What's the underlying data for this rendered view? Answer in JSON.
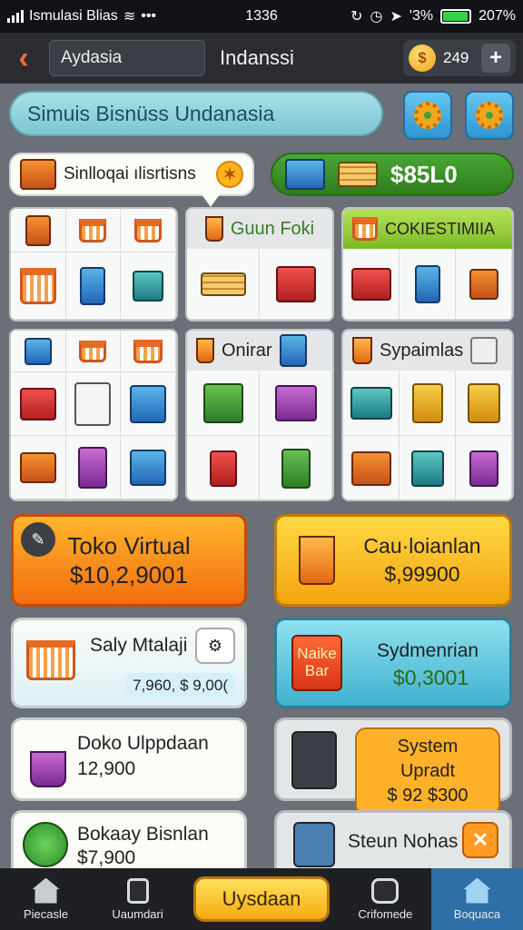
{
  "status_bar": {
    "carrier": "Ismulasi Blias",
    "time": "1336",
    "battery": "207%",
    "signal_pct": "'3%"
  },
  "top_bar": {
    "field_value": "Aydasia",
    "title": "Indanssi",
    "coins": "249"
  },
  "banner": {
    "title": "Simuis Bisnüss Undanasia"
  },
  "chips": {
    "left_label": "Sinlloqai ılisrtisns",
    "right_value": "$85L0"
  },
  "panels": {
    "mid_top_label": "Guun Foki",
    "right_top_label": "COKIESTIMIIA",
    "mid_bottom_label": "Onirar",
    "right_bottom_label": "Sypaimlas"
  },
  "cards": [
    {
      "title": "Toko Virtual",
      "value": "$10,2,9001"
    },
    {
      "title": "Cau·loianlan",
      "value": "$,99900"
    },
    {
      "title": "Saly Mtalaji",
      "value": "7,960, $ 9,00("
    },
    {
      "title": "Sydmenrian",
      "value": "$0,3001",
      "badge": "Naike Bar"
    },
    {
      "title": "Doko Ulppdaan",
      "value": "12,900"
    },
    {
      "title": "System Upradt",
      "value": "$ 92 $300"
    },
    {
      "title": "Bokaay Bisnlan",
      "value": "$7,900"
    },
    {
      "title": "Steun Nohas",
      "value": ""
    }
  ],
  "nav": [
    {
      "label": "Piecasle"
    },
    {
      "label": "Uaumdari"
    },
    {
      "label": "Uysdaan"
    },
    {
      "label": "Crifomede"
    },
    {
      "label": "Boquaca"
    }
  ]
}
